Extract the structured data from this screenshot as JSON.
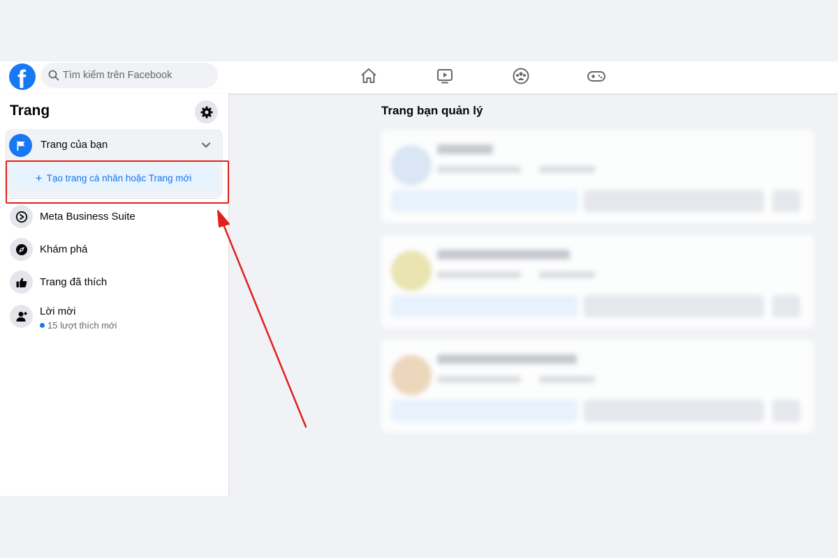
{
  "topbar": {
    "logo_letter": "f",
    "search_placeholder": "Tìm kiếm trên Facebook",
    "nav": [
      "home-icon",
      "video-icon",
      "groups-icon",
      "gaming-icon"
    ]
  },
  "sidebar": {
    "title": "Trang",
    "your_pages_label": "Trang của bạn",
    "create_label": "Tạo trang cá nhân hoặc Trang mới",
    "items": [
      {
        "label": "Meta Business Suite",
        "icon": "meta-business-suite-icon"
      },
      {
        "label": "Khám phá",
        "icon": "compass-icon"
      },
      {
        "label": "Trang đã thích",
        "icon": "thumbs-up-icon"
      },
      {
        "label": "Lời mời",
        "icon": "invite-user-icon",
        "sub": "15 lượt thích mới"
      }
    ]
  },
  "main": {
    "title": "Trang bạn quản lý"
  },
  "colors": {
    "brand": "#1877f2",
    "highlight": "#e0201c",
    "arrow": "#e0201c"
  }
}
